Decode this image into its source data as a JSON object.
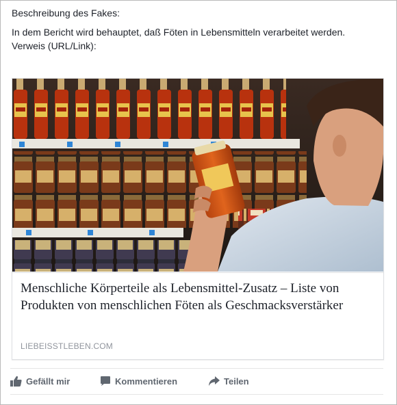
{
  "post": {
    "line_title": "Beschreibung des Fakes:",
    "line_body": "In dem Bericht wird behauptet, daß Föten in Lebensmitteln verarbeitet werden.",
    "line_ref": "Verweis (URL/Link):"
  },
  "link_card": {
    "image_icon": "supermarket-shelf-photo",
    "headline": "Menschliche Körperteile als Lebensmittel-Zusatz – Liste von Produkten von menschlichen Föten als Geschmacksverstärker",
    "domain": "LIEBEISSTLEBEN.COM"
  },
  "actions": {
    "like": "Gefällt mir",
    "comment": "Kommentieren",
    "share": "Teilen"
  },
  "colors": {
    "action_text": "#606770",
    "domain_text": "#90949c",
    "border": "#dddfe2"
  }
}
